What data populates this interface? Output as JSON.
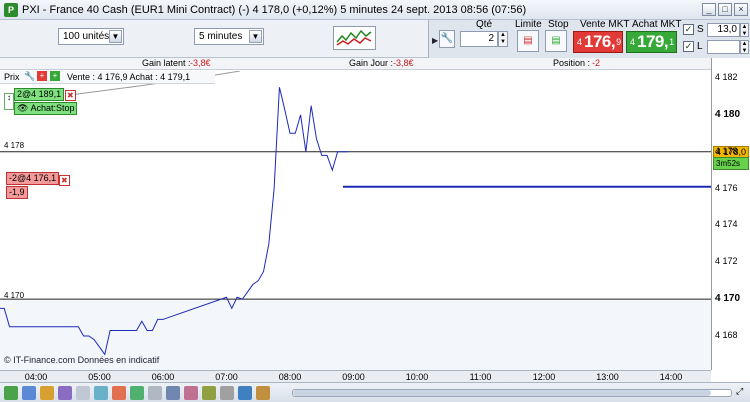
{
  "window": {
    "title": "PXI - France 40 Cash (EUR1 Mini Contract) (-)   4 178,0 (+0,12%)   5 minutes   24 sept. 2013 08:56 (07:56)"
  },
  "toolbar": {
    "quantity_select": "100 unités",
    "period_select": "5 minutes"
  },
  "order": {
    "qty_label": "Qté",
    "qty_value": "2",
    "limit_label": "Limite",
    "stop_label": "Stop",
    "sell_label": "Vente MKT",
    "buy_label": "Achat MKT",
    "sell_price": {
      "small": "4",
      "big": "176,",
      "tiny": "9"
    },
    "buy_price": {
      "small": "4",
      "big": "179,",
      "tiny": "1"
    },
    "s_label": "S",
    "l_label": "L",
    "s_value": "13,0",
    "l_value": "",
    "s_checked": "✓",
    "l_checked": "✓"
  },
  "info": {
    "gain_latent_label": "Gain latent :",
    "gain_latent_value": "-3,8€",
    "gain_jour_label": "Gain Jour :",
    "gain_jour_value": "-3,8€",
    "position_label": "Position :",
    "position_value": "-2"
  },
  "pricebar": {
    "label": "Prix",
    "quote": "Vente : 4 176,9  Achat : 4 179,1"
  },
  "order_tags": {
    "buy_stop_qty": "2@4 189,1",
    "buy_stop_label": "Achat:Stop",
    "position_tag": "-2@4 176,1",
    "position_pnl": "-1,9"
  },
  "chart_labels": {
    "level_upper": "4 178",
    "level_lower": "4 170",
    "source": "© IT-Finance.com  Données en indicatif",
    "last_price": "4 178,0",
    "countdown": "3m52s"
  },
  "chart_data": {
    "type": "line",
    "x_ticks": [
      "04:00",
      "05:00",
      "06:00",
      "07:00",
      "08:00",
      "09:00",
      "10:00",
      "11:00",
      "12:00",
      "13:00",
      "14:00"
    ],
    "y_ticks": [
      "4 182",
      "4 180",
      "4 178",
      "4 176",
      "4 174",
      "4 172",
      "4 170",
      "4 168"
    ],
    "ylim": [
      4167,
      4183
    ],
    "series": [
      {
        "x": [
          "03:20",
          "03:25",
          "03:30",
          "03:35",
          "03:40",
          "04:40",
          "04:45",
          "04:50",
          "04:55",
          "05:00",
          "05:05",
          "05:10",
          "05:15",
          "05:30",
          "05:35",
          "05:40",
          "05:45",
          "05:50",
          "05:55",
          "06:00",
          "06:05",
          "06:55",
          "07:00",
          "07:05",
          "07:10",
          "07:15",
          "07:20",
          "07:25",
          "07:30",
          "07:35",
          "07:40",
          "07:45",
          "07:50",
          "07:55",
          "08:00",
          "08:05",
          "08:10",
          "08:15",
          "08:20",
          "08:25",
          "08:30",
          "08:35",
          "08:40",
          "08:45",
          "08:50",
          "08:55"
        ],
        "values": [
          4170.0,
          4169.5,
          4169.5,
          4168.5,
          4168.5,
          4168.5,
          4168.0,
          4168.0,
          4167.8,
          4167.4,
          4167.0,
          4168.3,
          4168.3,
          4168.3,
          4168.3,
          4168.8,
          4168.3,
          4168.3,
          4168.9,
          4168.9,
          4169.0,
          4170.0,
          4170.1,
          4169.5,
          4170.1,
          4170.0,
          4170.4,
          4170.8,
          4171.0,
          4171.5,
          4173.0,
          4176.0,
          4181.5,
          4180.3,
          4179.0,
          4179.0,
          4180.0,
          4178.0,
          4180.5,
          4178.7,
          4177.8,
          4177.8,
          4177.0,
          4178.0,
          4178.0,
          4178.0
        ]
      }
    ],
    "horizontal_lines": [
      {
        "value": 4178.0,
        "label": "4 178"
      },
      {
        "value": 4170.0,
        "label": "4 170"
      }
    ],
    "position_line": {
      "value": 4176.1,
      "from": "08:50",
      "to": "14:45"
    },
    "stop_order_value": 4189.1,
    "grid": false,
    "last_price": 4178.0
  },
  "colors": {
    "line": "#1d2ab7",
    "sell": "#e23a36",
    "buy": "#37a938",
    "last_price_bg": "#f2b600",
    "countdown_bg": "#67d14b"
  }
}
